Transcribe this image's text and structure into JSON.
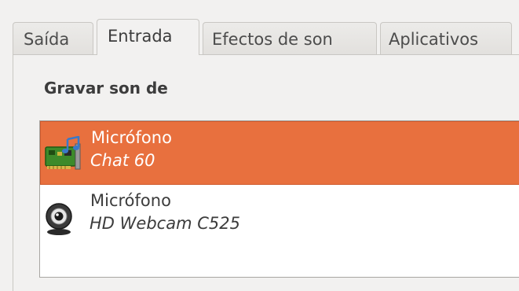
{
  "tabs": [
    {
      "label": "Saída",
      "active": false
    },
    {
      "label": "Entrada",
      "active": true
    },
    {
      "label": "Efectos de son",
      "active": false
    },
    {
      "label": "Aplicativos",
      "active": false
    }
  ],
  "section": {
    "label": "Gravar son de"
  },
  "devices": [
    {
      "name": "Micrófono",
      "description": "Chat 60",
      "icon": "sound-card-icon",
      "selected": true
    },
    {
      "name": "Micrófono",
      "description": "HD Webcam C525",
      "icon": "webcam-icon",
      "selected": false
    }
  ],
  "colors": {
    "selection": "#e8703e",
    "window_bg": "#f2f1f0",
    "text": "#3c3c3c"
  }
}
